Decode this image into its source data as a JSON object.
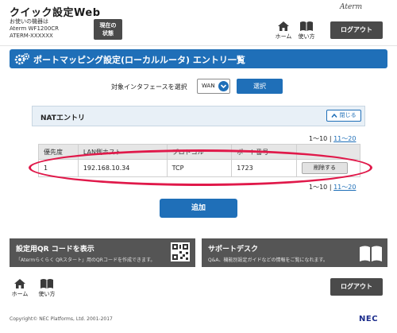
{
  "header": {
    "app_title": "クイック設定Web",
    "device_label": "お使いの機器は",
    "device_model": "Aterm WF1200CR",
    "device_id": "ATERM-XXXXXX",
    "status_button": "現在の\n状態",
    "brand_logo": "Aterm",
    "home_label": "ホーム",
    "help_label": "使い方",
    "logout_label": "ログアウト"
  },
  "page": {
    "title": "ポートマッピング設定(ローカルルータ) エントリ一覧",
    "interface_label": "対象インタフェースを選択",
    "interface_value": "WAN",
    "select_button": "選択"
  },
  "nat_section": {
    "title": "NATエントリ",
    "close_button": "閉じる",
    "pager_current": "1〜10",
    "pager_separator": "|",
    "pager_next": "11〜20"
  },
  "table": {
    "headers": [
      "優先度",
      "LAN側ホスト",
      "プロトコル",
      "ポート番号",
      ""
    ],
    "rows": [
      {
        "priority": "1",
        "lan_host": "192.168.10.34",
        "protocol": "TCP",
        "port": "1723",
        "action": "削除する"
      }
    ]
  },
  "add_button": "追加",
  "panels": {
    "qr_title": "設定用QR コードを表示",
    "qr_desc": "「Atermらくらく QRスタート」用のQRコードを作成できます。",
    "support_title": "サポートデスク",
    "support_desc": "Q&A、機能別設定ガイドなどの情報をご覧になれます。"
  },
  "footer": {
    "home_label": "ホーム",
    "help_label": "使い方",
    "logout_label": "ログアウト",
    "copyright": "Copyright© NEC Platforms, Ltd. 2001-2017",
    "nec_logo": "NEC"
  },
  "colors": {
    "primary_blue": "#1f6fb8",
    "dark_gray": "#4a4a4a",
    "highlight_red": "#e0194a"
  }
}
